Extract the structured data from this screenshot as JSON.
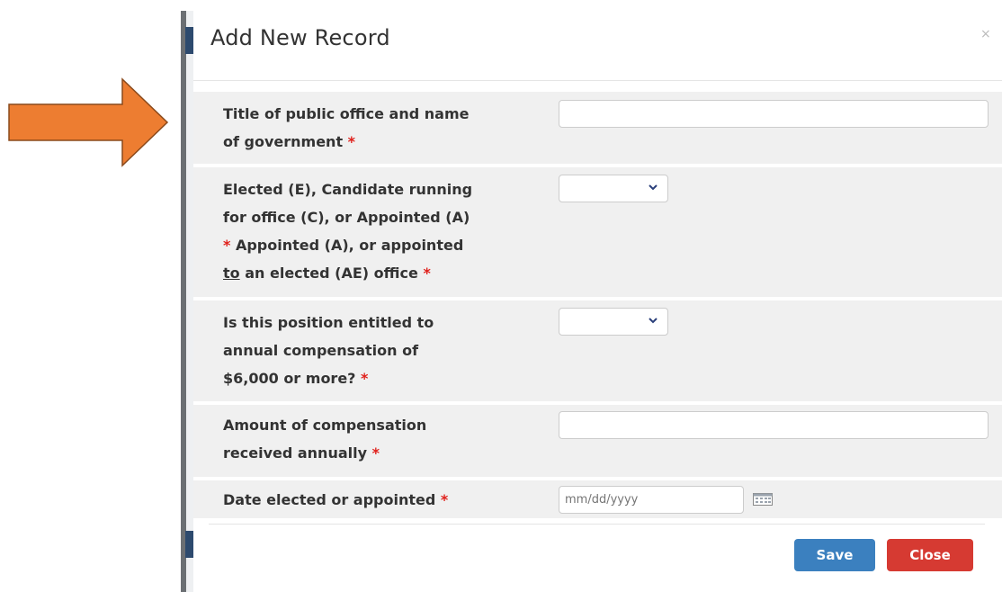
{
  "modal": {
    "title": "Add New Record",
    "close_glyph": "×"
  },
  "form": {
    "title_field": {
      "label_line1": "Title of public office and name",
      "label_line2": "of government",
      "required_mark": "*",
      "value": ""
    },
    "status_field": {
      "label_line1": "Elected (E), Candidate running",
      "label_line2": "for office (C), or Appointed (A)",
      "label_line3_mark": "*",
      "label_line3_text": "Appointed (A), or appointed",
      "label_line4_under": "to",
      "label_line4_text": "an elected (AE) office",
      "required_mark": "*",
      "selected": ""
    },
    "compensation_entitled_field": {
      "label_line1": "Is this position entitled to",
      "label_line2": "annual compensation of",
      "label_line3": "$6,000 or more?",
      "required_mark": "*",
      "selected": ""
    },
    "amount_field": {
      "label_line1": "Amount of compensation",
      "label_line2": "received annually",
      "required_mark": "*",
      "value": ""
    },
    "date_field": {
      "label": "Date elected or appointed",
      "required_mark": "*",
      "placeholder": "mm/dd/yyyy"
    }
  },
  "footer": {
    "save_label": "Save",
    "close_label": "Close"
  },
  "icons": {
    "arrow": "arrow-right-icon",
    "chevron": "chevron-down-icon",
    "calendar": "calendar-icon"
  },
  "colors": {
    "arrow_fill": "#ed7d31",
    "required": "#e0201b",
    "save": "#3b80bf",
    "close": "#d63a32"
  }
}
